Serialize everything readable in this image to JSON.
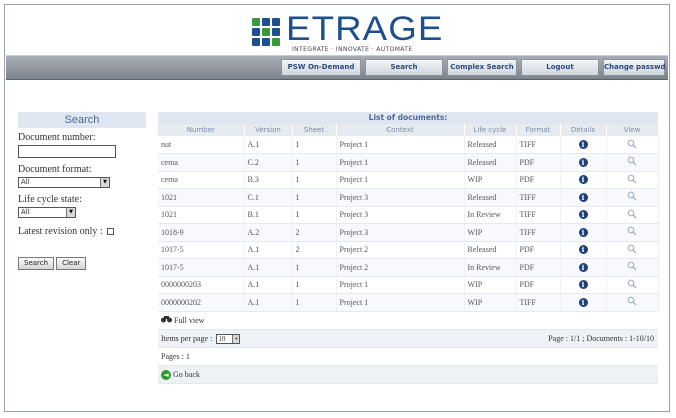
{
  "brand": {
    "name": "ETRAGE",
    "tagline": "INTEGRATE · INNOVATE · AUTOMATE",
    "colors": {
      "primary": "#1e4f8f",
      "accent": "#3a9a3a"
    }
  },
  "nav": {
    "items": [
      {
        "label": "PSW On-Demand"
      },
      {
        "label": "Search"
      },
      {
        "label": "Complex Search"
      },
      {
        "label": "Logout"
      },
      {
        "label": "Change passwd"
      }
    ]
  },
  "search": {
    "title": "Search",
    "doc_number_label": "Document number:",
    "doc_number_value": "",
    "doc_format_label": "Document format:",
    "doc_format_value": "All",
    "lifecycle_label": "Life cycle state:",
    "lifecycle_value": "All",
    "latest_revision_label": "Latest revision only :",
    "latest_revision_checked": false,
    "search_button": "Search",
    "clear_button": "Clear"
  },
  "list": {
    "title": "List of documents:",
    "columns": [
      "Number",
      "Version",
      "Sheet",
      "Context",
      "Life cycle",
      "Format",
      "Details",
      "View"
    ],
    "rows": [
      {
        "number": "nut",
        "version": "A.1",
        "sheet": "1",
        "context": "Project 1",
        "lifecycle": "Released",
        "format": "TIFF"
      },
      {
        "number": "cema",
        "version": "C.2",
        "sheet": "1",
        "context": "Project 1",
        "lifecycle": "Released",
        "format": "PDF"
      },
      {
        "number": "cema",
        "version": "B.3",
        "sheet": "1",
        "context": "Project 1",
        "lifecycle": "WIP",
        "format": "PDF"
      },
      {
        "number": "1021",
        "version": "C.1",
        "sheet": "1",
        "context": "Project 3",
        "lifecycle": "Released",
        "format": "TIFF"
      },
      {
        "number": "1021",
        "version": "B.1",
        "sheet": "1",
        "context": "Project 3",
        "lifecycle": "In Review",
        "format": "TIFF"
      },
      {
        "number": "1018-9",
        "version": "A.2",
        "sheet": "2",
        "context": "Project 3",
        "lifecycle": "WIP",
        "format": "TIFF"
      },
      {
        "number": "1017-5",
        "version": "A.1",
        "sheet": "2",
        "context": "Project 2",
        "lifecycle": "Released",
        "format": "PDF"
      },
      {
        "number": "1017-5",
        "version": "A.1",
        "sheet": "1",
        "context": "Project 2",
        "lifecycle": "In Review",
        "format": "PDF"
      },
      {
        "number": "0000000203",
        "version": "A.1",
        "sheet": "1",
        "context": "Project 1",
        "lifecycle": "WIP",
        "format": "PDF"
      },
      {
        "number": "0000000202",
        "version": "A.1",
        "sheet": "1",
        "context": "Project 1",
        "lifecycle": "WIP",
        "format": "TIFF"
      }
    ],
    "full_view_label": "Full view",
    "items_per_page_label": "Items per page :",
    "items_per_page_value": "10",
    "page_info_label": "Page :",
    "page_info_value": "1/1",
    "documents_label": "Documents :",
    "documents_value": "1-10/10",
    "pages_label": "Pages :",
    "pages_value": "1",
    "go_back_label": "Go back"
  }
}
